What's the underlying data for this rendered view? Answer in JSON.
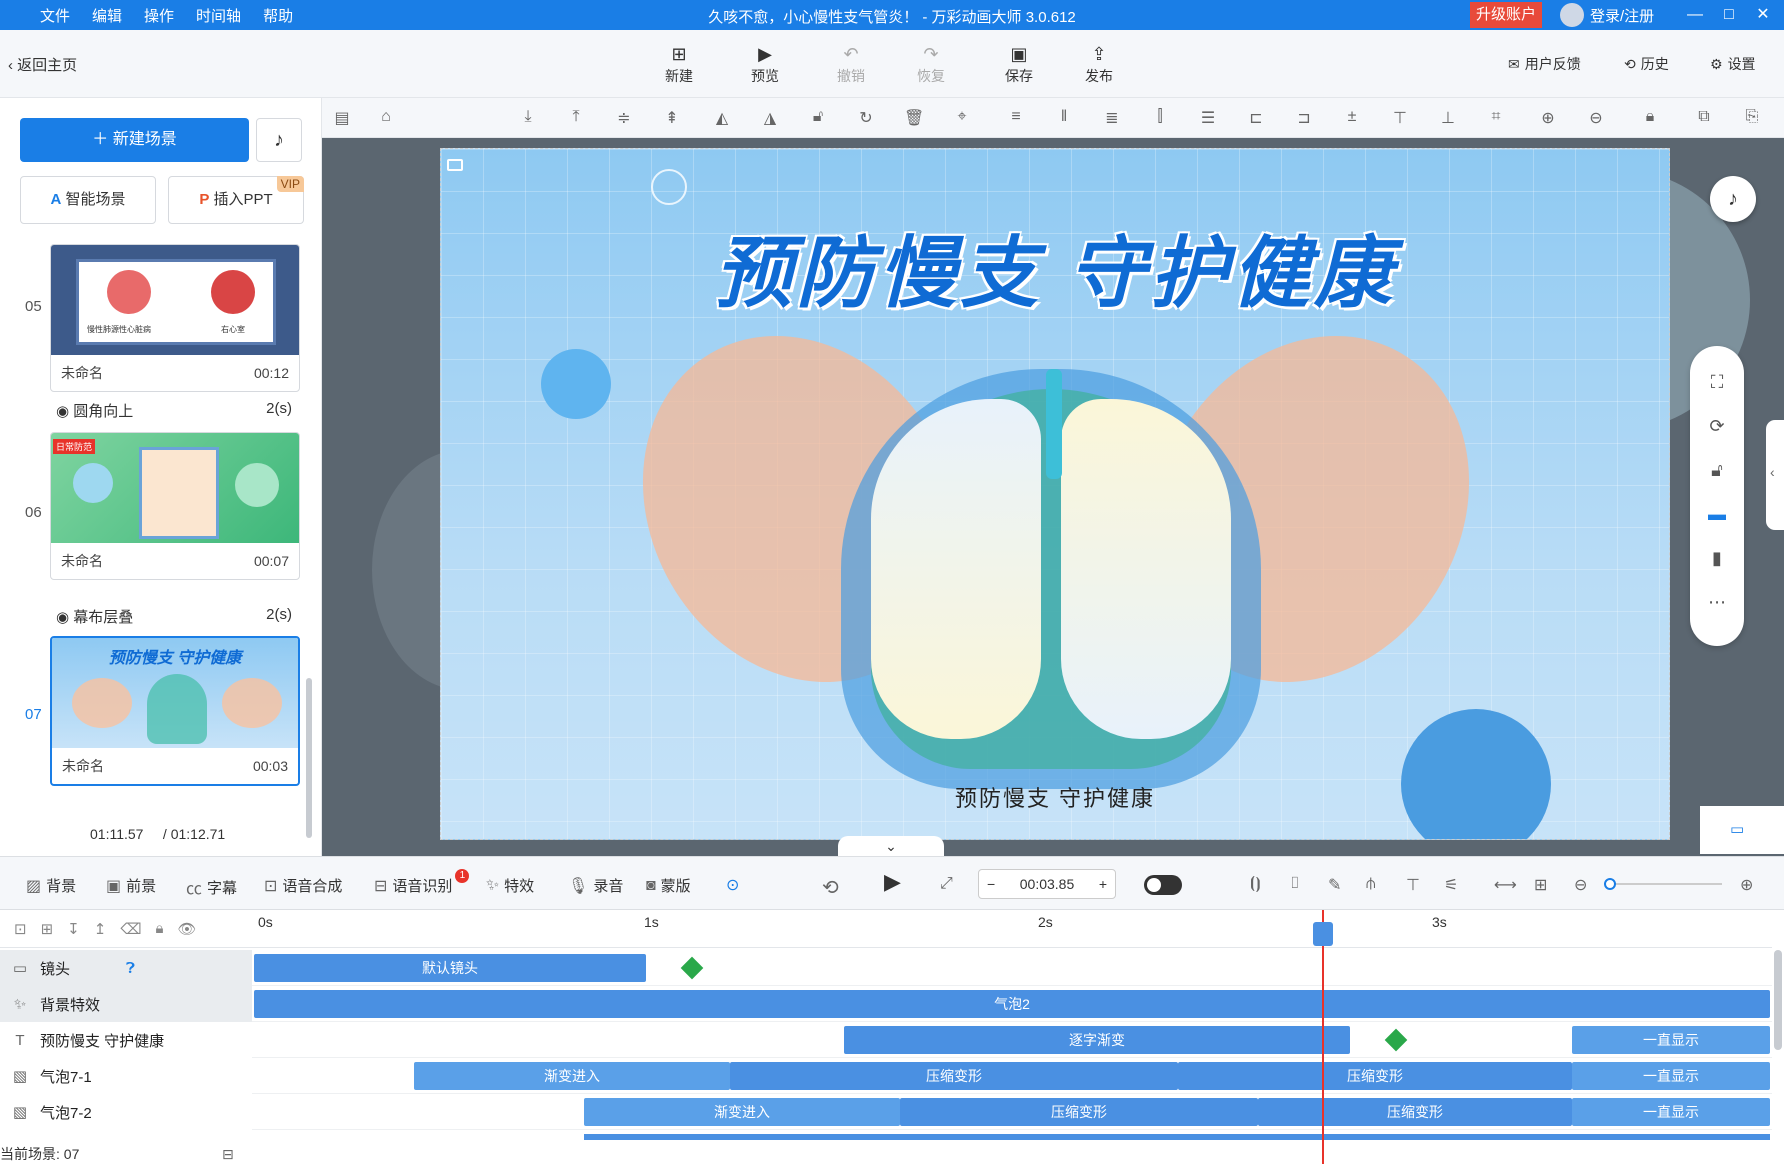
{
  "menu": [
    "文件",
    "编辑",
    "操作",
    "时间轴",
    "帮助"
  ],
  "window_title": "久咳不愈，小心慢性支气管炎！ - 万彩动画大师 3.0.612",
  "upgrade_label": "升级账户",
  "login_label": "登录/注册",
  "back_label": "返回主页",
  "toolbar": {
    "new": "新建",
    "preview": "预览",
    "undo": "撤销",
    "redo": "恢复",
    "save": "保存",
    "publish": "发布"
  },
  "right_toolbar": {
    "feedback": "用户反馈",
    "history": "历史",
    "settings": "设置"
  },
  "left": {
    "new_scene": "新建场景",
    "smart_scene": "智能场景",
    "insert_ppt": "插入PPT",
    "vip": "VIP",
    "scenes": [
      {
        "num": "05",
        "name": "未命名",
        "time": "00:12"
      },
      {
        "num": "06",
        "name": "未命名",
        "time": "00:07"
      },
      {
        "num": "07",
        "name": "未命名",
        "time": "00:03"
      }
    ],
    "transitions": [
      {
        "name": "圆角向上",
        "dur": "2(s)"
      },
      {
        "name": "幕布层叠",
        "dur": "2(s)"
      }
    ],
    "scene5_caption_a": "慢性肺源性心脏病",
    "scene5_caption_b": "右心室",
    "scene6_tag": "日常防范",
    "current_time": "01:11.57",
    "total_time": "/ 01:12.71"
  },
  "canvas": {
    "headline": "预防慢支 守护健康",
    "subtitle": "预防慢支 守护健康"
  },
  "thumb7_title": "预防慢支 守护健康",
  "bottom": {
    "items": [
      "背景",
      "前景",
      "字幕",
      "语音合成",
      "语音识别",
      "特效",
      "录音",
      "蒙版"
    ],
    "badge": "1",
    "timecode": "00:03.85"
  },
  "timeline": {
    "ruler": [
      "0s",
      "1s",
      "2s",
      "3s"
    ],
    "rows": [
      {
        "name": "镜头",
        "segs": [
          "默认镜头"
        ]
      },
      {
        "name": "背景特效",
        "segs": [
          "气泡2"
        ]
      },
      {
        "name": "预防慢支 守护健康",
        "segs": [
          "逐字渐变",
          "一直显示"
        ]
      },
      {
        "name": "气泡7-1",
        "segs": [
          "渐变进入",
          "压缩变形",
          "压缩变形",
          "一直显示"
        ]
      },
      {
        "name": "气泡7-2",
        "segs": [
          "渐变进入",
          "压缩变形",
          "压缩变形",
          "一直显示"
        ]
      }
    ]
  },
  "status": "当前场景: 07"
}
